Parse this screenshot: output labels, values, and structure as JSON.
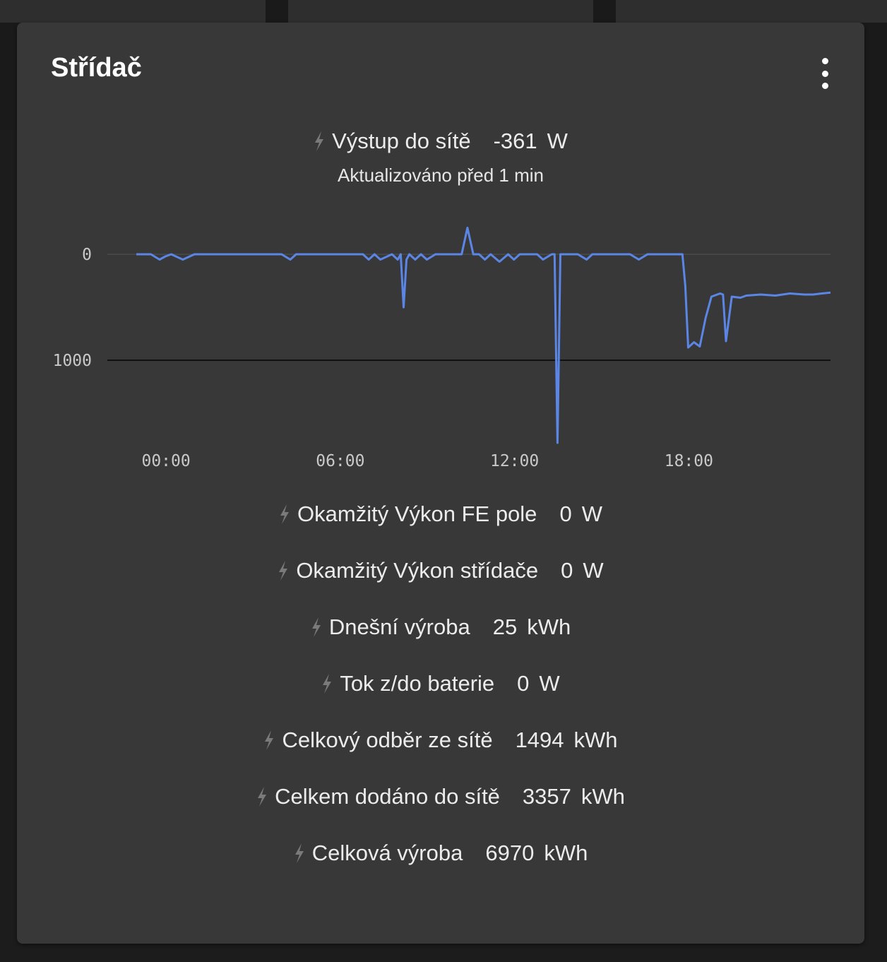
{
  "card": {
    "title": "Střídač",
    "menu_icon": "more-vertical-icon"
  },
  "main_entity": {
    "icon": "flash-icon",
    "label": "Výstup do sítě",
    "value": "-361",
    "unit": "W",
    "updated": "Aktualizováno před 1 min"
  },
  "chart_data": {
    "type": "line",
    "series": [
      {
        "color": "#5b86e5",
        "x": [
          0.0,
          0.5,
          0.8,
          1.0,
          1.2,
          1.6,
          2.0,
          2.2,
          2.4,
          3.0,
          4.0,
          5.0,
          5.3,
          5.5,
          6.0,
          7.0,
          7.8,
          8.0,
          8.2,
          8.4,
          8.8,
          9.0,
          9.1,
          9.2,
          9.3,
          9.4,
          9.6,
          9.8,
          10.0,
          10.3,
          10.5,
          10.8,
          11.0,
          11.2,
          11.4,
          11.6,
          11.8,
          12.0,
          12.2,
          12.5,
          12.8,
          13.0,
          13.2,
          13.5,
          13.8,
          14.0,
          14.3,
          14.4,
          14.5,
          14.6,
          14.7,
          14.9,
          15.2,
          15.5,
          15.7,
          16.0,
          16.5,
          17.0,
          17.3,
          17.6,
          17.8,
          18.0,
          18.2,
          18.4,
          18.6,
          18.7,
          18.8,
          18.9,
          19.0,
          19.2,
          19.4,
          19.6,
          19.8,
          20.0,
          20.1,
          20.2,
          20.3,
          20.5,
          20.8,
          21.0,
          21.5,
          22.0,
          22.5,
          23.0,
          23.3,
          23.6,
          23.9
        ],
        "values": [
          0,
          0,
          -50,
          -20,
          0,
          -50,
          0,
          0,
          0,
          0,
          0,
          0,
          -50,
          0,
          0,
          0,
          0,
          -50,
          0,
          -50,
          0,
          -50,
          0,
          -500,
          -50,
          0,
          -50,
          0,
          -50,
          0,
          0,
          0,
          0,
          0,
          250,
          0,
          0,
          -50,
          0,
          -70,
          0,
          -50,
          0,
          0,
          0,
          -50,
          0,
          0,
          -1780,
          0,
          0,
          0,
          0,
          -50,
          0,
          0,
          0,
          0,
          -50,
          0,
          0,
          0,
          0,
          0,
          0,
          0,
          0,
          -300,
          -880,
          -830,
          -870,
          -600,
          -400,
          -380,
          -370,
          -380,
          -820,
          -400,
          -410,
          -390,
          -380,
          -390,
          -370,
          -380,
          -380,
          -370,
          -361
        ],
        "values_note": "",
        "line_width": 3
      }
    ],
    "x_ticks": [
      0,
      6,
      12,
      18
    ],
    "x_tick_labels": [
      "00:00",
      "06:00",
      "12:00",
      "18:00"
    ],
    "xlim": [
      -1,
      23.9
    ],
    "y_ticks": [
      0,
      -1000
    ],
    "y_tick_labels": [
      "0",
      "1000"
    ],
    "ylim": [
      -1800,
      300
    ],
    "grid": true,
    "xlabel": "",
    "ylabel": ""
  },
  "entities": [
    {
      "icon": "flash-icon",
      "label": "Okamžitý Výkon FE pole",
      "value": "0",
      "unit": "W"
    },
    {
      "icon": "flash-icon",
      "label": "Okamžitý Výkon střídače",
      "value": "0",
      "unit": "W"
    },
    {
      "icon": "flash-icon",
      "label": "Dnešní výroba",
      "value": "25",
      "unit": "kWh"
    },
    {
      "icon": "flash-icon",
      "label": "Tok z/do baterie",
      "value": "0",
      "unit": "W"
    },
    {
      "icon": "flash-icon",
      "label": "Celkový odběr ze sítě",
      "value": "1494",
      "unit": "kWh"
    },
    {
      "icon": "flash-icon",
      "label": "Celkem dodáno do sítě",
      "value": "3357",
      "unit": "kWh"
    },
    {
      "icon": "flash-icon",
      "label": "Celková výroba",
      "value": "6970",
      "unit": "kWh"
    }
  ]
}
